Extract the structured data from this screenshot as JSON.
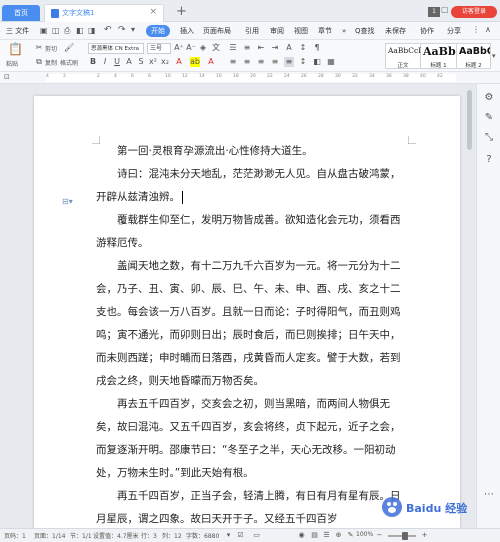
{
  "titlebar": {
    "home_tab": "首页",
    "doc_tab": "文字文稿1",
    "add_tab": "+",
    "badge": "1",
    "login": "访客登录"
  },
  "menubar": {
    "file": "三 文件",
    "items": [
      "插入",
      "页面布局",
      "引用",
      "审阅",
      "视图",
      "章节",
      "开发工具",
      "特色功能"
    ],
    "start": "开始",
    "search": "Q查找",
    "right_items": [
      "未保存",
      "协作",
      "分享"
    ]
  },
  "toolbar": {
    "paste": "粘贴",
    "cut": "剪切",
    "copy": "复制",
    "format_painter": "格式刷",
    "font": "思源黑体 CN Extra",
    "size": "三号",
    "styles": [
      {
        "sample": "AaBbCcDd",
        "name": "正文"
      },
      {
        "sample": "AaBb",
        "name": "标题 1"
      },
      {
        "sample": "AaBbC",
        "name": "标题 2"
      }
    ]
  },
  "ruler": {
    "numbers": [
      "4",
      "2",
      "",
      "2",
      "4",
      "6",
      "8",
      "10",
      "12",
      "14",
      "16",
      "18",
      "20",
      "22",
      "24",
      "26",
      "28",
      "30",
      "32",
      "34",
      "36",
      "38",
      "40",
      "42"
    ]
  },
  "document": {
    "paragraphs": [
      "第一回·灵根育孕源流出·心性修持大道生。",
      "诗曰：混沌未分天地乱，茫茫渺渺无人见。自从盘古破鸿蒙，开辟从兹清浊辨。",
      "覆载群生仰至仁，发明万物皆成善。欲知造化会元功，须看西游释厄传。",
      "盖闻天地之数，有十二万九千六百岁为一元。将一元分为十二会，乃子、丑、寅、卯、辰、巳、午、未、申、酉、戌、亥之十二支也。每会该一万八百岁。且就一日而论：子时得阳气，而丑则鸡鸣；寅不通光，而卯则日出；辰时食后，而巳则挨排；日午天中，而未则西蹉；申时晡而日落酉，戌黄昏而人定亥。譬于大数，若到戌会之终，则天地昏曚而万物否矣。",
      "再去五千四百岁，交亥会之初，则当黑暗，而两间人物俱无矣，故曰混沌。又五千四百岁，亥会将终，贞下起元，近子之会，而复逐渐开明。邵康节曰：“冬至子之半，天心无改移。一阳初动处，万物未生时。”到此天始有根。",
      "再五千四百岁，正当子会，轻清上腾，有日有月有星有辰。日月星辰，谓之四象。故曰天开于子。又经五千四百岁"
    ]
  },
  "statusbar": {
    "page": "页码：1",
    "pages": "页面：1/14",
    "section": "节：1/1",
    "setting": "设置值：4.7厘米",
    "row": "行：3",
    "col": "列：12",
    "words": "字数：6880",
    "zoom": "100%"
  },
  "watermark": {
    "text": "Baidu 经验"
  }
}
